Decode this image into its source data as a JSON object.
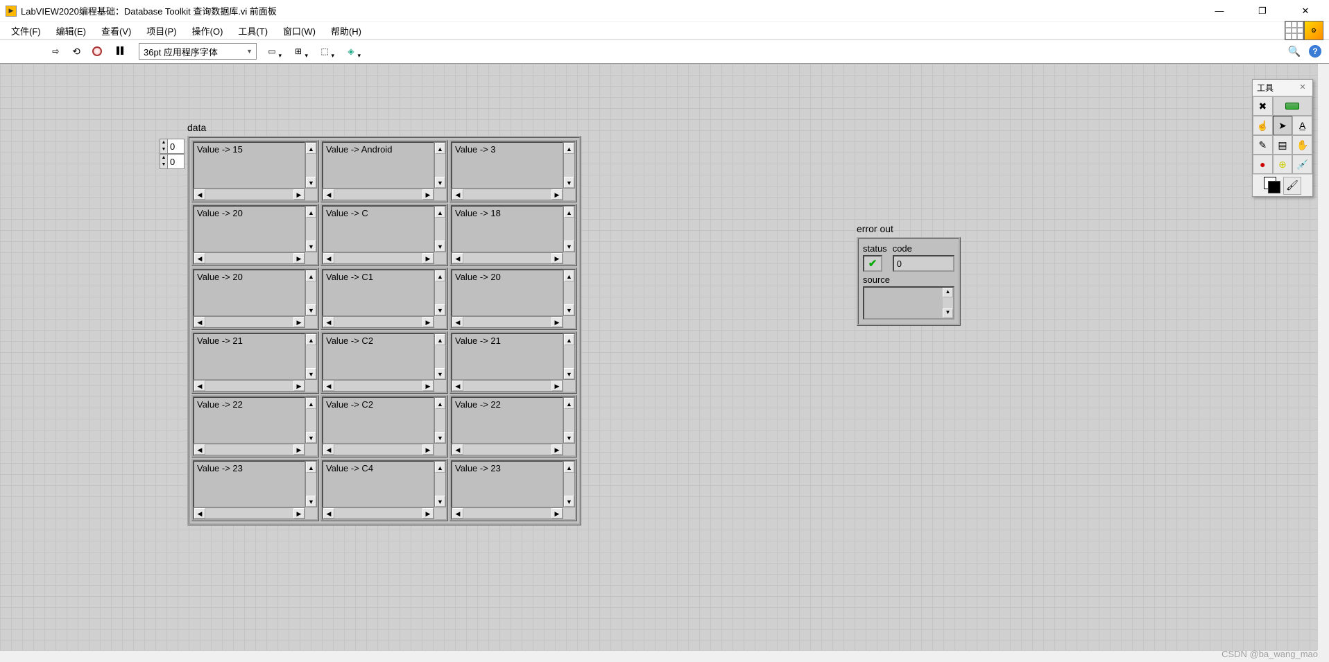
{
  "title": "LabVIEW2020编程基础：Database Toolkit 查询数据库.vi 前面板",
  "menu": {
    "file": "文件(F)",
    "edit": "编辑(E)",
    "view": "查看(V)",
    "project": "项目(P)",
    "operate": "操作(O)",
    "tools": "工具(T)",
    "window": "窗口(W)",
    "help": "帮助(H)"
  },
  "toolbar": {
    "font": "36pt 应用程序字体"
  },
  "data_label": "data",
  "idx": {
    "row": "0",
    "col": "0"
  },
  "grid": [
    [
      {
        "v": "Value -> 15"
      },
      {
        "v": "Value -> Android"
      },
      {
        "v": "Value -> 3"
      }
    ],
    [
      {
        "v": "Value -> 20"
      },
      {
        "v": "Value -> C"
      },
      {
        "v": "Value -> 18"
      }
    ],
    [
      {
        "v": "Value -> 20"
      },
      {
        "v": "Value -> C1"
      },
      {
        "v": "Value -> 20"
      }
    ],
    [
      {
        "v": "Value -> 21"
      },
      {
        "v": "Value -> C2"
      },
      {
        "v": "Value -> 21"
      }
    ],
    [
      {
        "v": "Value -> 22"
      },
      {
        "v": "Value -> C2"
      },
      {
        "v": "Value -> 22"
      }
    ],
    [
      {
        "v": "Value -> 23"
      },
      {
        "v": "Value -> C4"
      },
      {
        "v": "Value -> 23"
      }
    ]
  ],
  "error": {
    "title": "error out",
    "status_label": "status",
    "code_label": "code",
    "code_value": "0",
    "source_label": "source",
    "source_value": ""
  },
  "tools_palette": {
    "title": "工具"
  },
  "watermark": "CSDN @ba_wang_mao"
}
